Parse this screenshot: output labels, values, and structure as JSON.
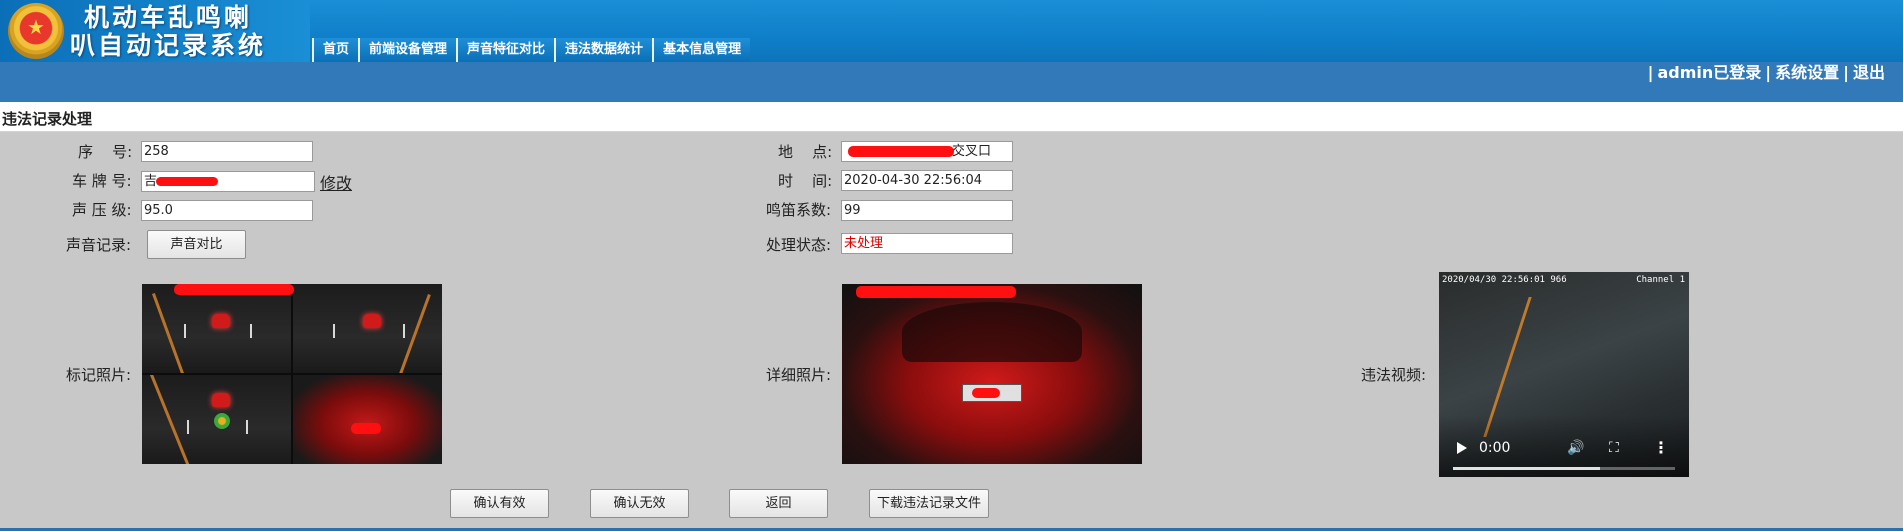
{
  "app": {
    "title_line1": "机动车乱鸣喇",
    "title_line2": "叭自动记录系统",
    "emblem_icon": "police-emblem-icon"
  },
  "nav": {
    "items": [
      {
        "label": "首页"
      },
      {
        "label": "前端设备管理"
      },
      {
        "label": "声音特征对比"
      },
      {
        "label": "违法数据统计"
      },
      {
        "label": "基本信息管理"
      }
    ]
  },
  "userbar": {
    "sep1": "|",
    "user": "admin已登录",
    "sep2": "|",
    "settings": "系统设置",
    "sep3": "|",
    "logout": "退出"
  },
  "section": {
    "title": "违法记录处理"
  },
  "form": {
    "serial_label": "序    号:",
    "serial_value": "258",
    "plate_label": "车 牌 号:",
    "plate_value": "吉",
    "modify_link": "修改",
    "spl_label": "声 压 级:",
    "spl_value": "95.0",
    "sound_label": "声音记录:",
    "sound_button": "声音对比",
    "location_label": "地    点:",
    "location_value": "交叉口",
    "time_label": "时    间:",
    "time_value": "2020-04-30 22:56:04",
    "horn_label": "鸣笛系数:",
    "horn_value": "99",
    "status_label": "处理状态:",
    "status_value": "未处理"
  },
  "media": {
    "marked_photo_label": "标记照片:",
    "detail_photo_label": "详细照片:",
    "video_label": "违法视频:",
    "video_timestamp": "2020/04/30 22:56:01 966",
    "video_channel": "Channel 1",
    "video_time": "0:00",
    "video_progress": 0.66
  },
  "actions": {
    "confirm_valid": "确认有效",
    "confirm_invalid": "确认无效",
    "back": "返回",
    "download": "下载违法记录文件"
  },
  "colors": {
    "header": "#1a8fd6",
    "bar": "#3179b8",
    "status": "#e00000",
    "redaction": "#ff1010"
  }
}
